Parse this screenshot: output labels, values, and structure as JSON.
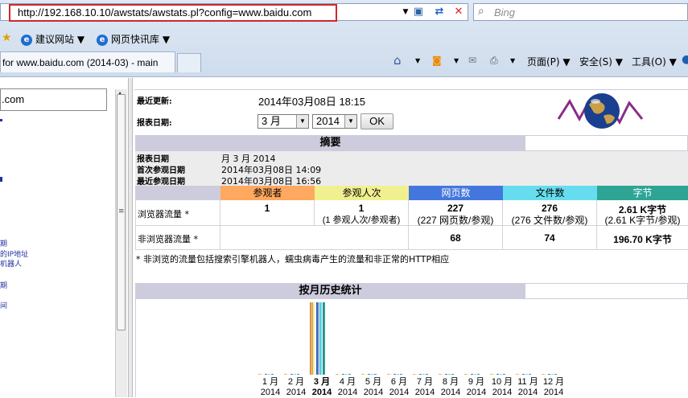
{
  "browser": {
    "url": "http://192.168.10.10/awstats/awstats.pl?config=www.baidu.com",
    "search_placeholder": "Bing",
    "favorites": [
      {
        "label": "建议网站 ▼"
      },
      {
        "label": "网页快讯库 ▼"
      }
    ],
    "tab_title": "for www.baidu.com (2014-03) - main",
    "commands": {
      "page": "页面(P) ▼",
      "safety": "安全(S) ▼",
      "tools": "工具(O) ▼"
    }
  },
  "left_frame": {
    "input_value": ".com",
    "links": [
      "期",
      "的IP地址",
      "机器人",
      "期",
      "间"
    ]
  },
  "report": {
    "last_update_label": "最近更新:",
    "last_update_value": "2014年03月08日 18:15",
    "period_label": "报表日期:",
    "month_select": "3 月",
    "year_select": "2014",
    "ok_label": "OK",
    "summary_title": "摘要",
    "summary_rows": [
      {
        "label": "报表日期",
        "value": "月 3 月 2014"
      },
      {
        "label": "首次参观日期",
        "value": "2014年03月08日 14:09"
      },
      {
        "label": "最近参观日期",
        "value": "2014年03月08日 16:56"
      }
    ],
    "columns": [
      {
        "label": "参观者",
        "color": "#ffa860"
      },
      {
        "label": "参观人次",
        "color": "#f0f090"
      },
      {
        "label": "网页数",
        "color": "#4477dd"
      },
      {
        "label": "文件数",
        "color": "#66ddee"
      },
      {
        "label": "字节",
        "color": "#2ea495"
      }
    ],
    "viewed_label": "浏览器流量 *",
    "viewed": {
      "visitors": "1",
      "visits": "1",
      "visits_sub": "(1 参观人次/参观者)",
      "pages": "227",
      "pages_sub": "(227 网页数/参观)",
      "hits": "276",
      "hits_sub": "(276 文件数/参观)",
      "bandwidth": "2.61 K字节",
      "bandwidth_sub": "(2.61 K字节/参观)"
    },
    "not_viewed_label": "非浏览器流量 *",
    "not_viewed": {
      "pages": "68",
      "hits": "74",
      "bandwidth": "196.70 K字节"
    },
    "footnote": "* 非浏览的流量包括搜索引擎机器人，蠕虫病毒产生的流量和非正常的HTTP相应",
    "history_title": "按月历史统计"
  },
  "chart_data": {
    "type": "bar",
    "categories": [
      "1 月",
      "2 月",
      "3 月",
      "4 月",
      "5 月",
      "6 月",
      "7 月",
      "8 月",
      "9 月",
      "10 月",
      "11 月",
      "12 月"
    ],
    "year_labels": [
      "2014",
      "2014",
      "2014",
      "2014",
      "2014",
      "2014",
      "2014",
      "2014",
      "2014",
      "2014",
      "2014",
      "2014"
    ],
    "highlight_index": 2,
    "series": [
      {
        "name": "参观者",
        "color": "#ffa860",
        "values": [
          0,
          0,
          1,
          0,
          0,
          0,
          0,
          0,
          0,
          0,
          0,
          0
        ]
      },
      {
        "name": "参观人次",
        "color": "#f0f090",
        "values": [
          0,
          0,
          1,
          0,
          0,
          0,
          0,
          0,
          0,
          0,
          0,
          0
        ]
      },
      {
        "name": "网页数",
        "color": "#4477dd",
        "values": [
          0,
          0,
          227,
          0,
          0,
          0,
          0,
          0,
          0,
          0,
          0,
          0
        ]
      },
      {
        "name": "文件数",
        "color": "#66ddee",
        "values": [
          0,
          0,
          276,
          0,
          0,
          0,
          0,
          0,
          0,
          0,
          0,
          0
        ]
      },
      {
        "name": "字节",
        "color": "#2ea495",
        "values": [
          0,
          0,
          2.61,
          0,
          0,
          0,
          0,
          0,
          0,
          0,
          0,
          0
        ]
      }
    ]
  }
}
